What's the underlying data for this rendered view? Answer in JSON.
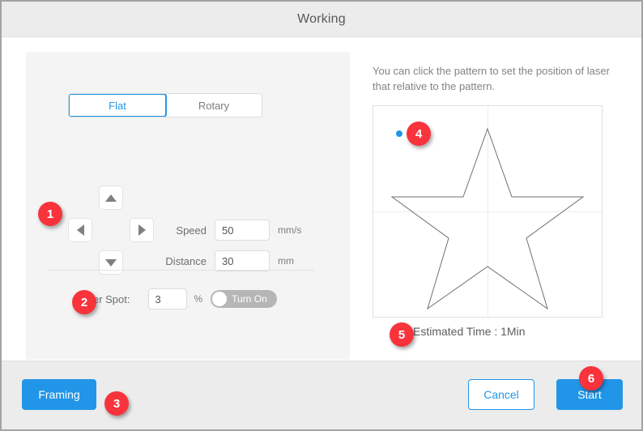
{
  "window": {
    "title": "Working"
  },
  "left_panel": {
    "tabs": [
      {
        "label": "Flat",
        "active": true
      },
      {
        "label": "Rotary",
        "active": false
      }
    ],
    "dpad": {
      "up": "up-arrow",
      "down": "down-arrow",
      "left": "left-arrow",
      "right": "right-arrow"
    },
    "speed": {
      "label": "Speed",
      "value": "50",
      "unit": "mm/s"
    },
    "distance": {
      "label": "Distance",
      "value": "30",
      "unit": "mm"
    },
    "laser_spot": {
      "label": "Laser Spot:",
      "value": "3",
      "unit": "%",
      "toggle_label": "Turn On",
      "toggle_state": "off"
    }
  },
  "right_panel": {
    "hint": "You can click the pattern to set the position of laser that relative to the pattern.",
    "preview": {
      "pattern": "star-outline",
      "laser_dot": "laser-position-dot",
      "grid": "crosshair"
    },
    "estimated_time": "Estimated Time : 1Min"
  },
  "footer": {
    "framing_label": "Framing",
    "cancel_label": "Cancel",
    "start_label": "Start"
  },
  "badges": [
    {
      "number": "1"
    },
    {
      "number": "2"
    },
    {
      "number": "3"
    },
    {
      "number": "4"
    },
    {
      "number": "5"
    },
    {
      "number": "6"
    }
  ],
  "colors": {
    "accent_blue": "#2196e8",
    "badge_red": "#f8333c",
    "panel_gray": "#f4f4f4",
    "chrome_gray": "#ececec"
  }
}
